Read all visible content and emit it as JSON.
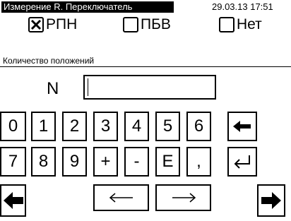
{
  "header": {
    "title": "Измерение R. Переключатель",
    "datetime": "29.03.13 17:51"
  },
  "options": [
    {
      "label": "РПН",
      "checked": true
    },
    {
      "label": "ПБВ",
      "checked": false
    },
    {
      "label": "Нет",
      "checked": false
    }
  ],
  "section": {
    "label": "Количество положений"
  },
  "input": {
    "label": "N",
    "value": ""
  },
  "keypad": {
    "row1": [
      "0",
      "1",
      "2",
      "3",
      "4",
      "5",
      "6"
    ],
    "row2": [
      "7",
      "8",
      "9",
      "+",
      "-",
      "E",
      ","
    ]
  },
  "icons": {
    "backspace": "backspace-arrow-icon",
    "enter": "enter-return-icon",
    "prev": "arrow-left-bold-icon",
    "next": "arrow-right-bold-icon",
    "cursor_left": "arrow-left-thin-icon",
    "cursor_right": "arrow-right-thin-icon"
  }
}
